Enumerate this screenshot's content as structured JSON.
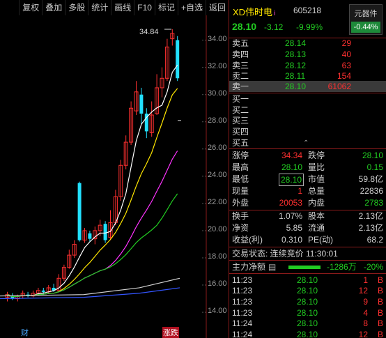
{
  "toolbar": [
    "复权",
    "叠加",
    "多股",
    "统计",
    "画线",
    "F10",
    "标记",
    "+自选",
    "返回"
  ],
  "chart": {
    "y_ticks": [
      "34.00",
      "32.00",
      "30.00",
      "28.00",
      "26.00",
      "24.00",
      "22.00",
      "20.00",
      "18.00",
      "16.00",
      "14.00"
    ],
    "peak_label": "34.84",
    "markers": {
      "cai": "财",
      "limit": "涨跌"
    },
    "colors": {
      "up": "#ff3030",
      "down": "#22e0ff",
      "ma5": "#ffffff",
      "ma10": "#ffe600",
      "ma20": "#ff33ff",
      "ma30": "#22cc22"
    }
  },
  "stock": {
    "name": "XD伟时电",
    "i": "i",
    "code": "605218",
    "price": "28.10",
    "change": "-3.12",
    "pct": "-9.99%",
    "element_label": "元器件",
    "element_value": "-0.44%"
  },
  "asks": [
    {
      "label": "卖五",
      "price": "28.14",
      "vol": "29"
    },
    {
      "label": "卖四",
      "price": "28.13",
      "vol": "40"
    },
    {
      "label": "卖三",
      "price": "28.12",
      "vol": "63"
    },
    {
      "label": "卖二",
      "price": "28.11",
      "vol": "154"
    },
    {
      "label": "卖一",
      "price": "28.10",
      "vol": "61062"
    }
  ],
  "bids": [
    "买一",
    "买二",
    "买三",
    "买四",
    "买五"
  ],
  "stats": {
    "zhangting_l": "涨停",
    "zhangting_v": "34.34",
    "dieting_l": "跌停",
    "dieting_v": "28.10",
    "high_l": "最高",
    "high_v": "28.10",
    "liangbi_l": "量比",
    "liangbi_v": "0.15",
    "low_l": "最低",
    "low_v": "28.10",
    "shizhi_l": "市值",
    "shizhi_v": "59.8亿",
    "xianliang_l": "现量",
    "xianliang_v": "1",
    "zongliang_l": "总量",
    "zongliang_v": "22836",
    "waipan_l": "外盘",
    "waipan_v": "20053",
    "neipan_l": "内盘",
    "neipan_v": "2783",
    "huanshou_l": "换手",
    "huanshou_v": "1.07%",
    "guben_l": "股本",
    "guben_v": "2.13亿",
    "jingzi_l": "净资",
    "jingzi_v": "5.85",
    "liutong_l": "流通",
    "liutong_v": "2.13亿",
    "shouyi_l": "收益(利)",
    "shouyi_v": "0.310",
    "pe_l": "PE(动)",
    "pe_v": "68.2"
  },
  "trade_status": "交易状态: 连续竞价 11:30:01",
  "main_flow": {
    "label": "主力净额",
    "value": "-1286万",
    "pct": "-20%"
  },
  "ticks": [
    {
      "time": "11:23",
      "price": "28.10",
      "vol": "1",
      "side": "B"
    },
    {
      "time": "11:23",
      "price": "28.10",
      "vol": "12",
      "side": "B"
    },
    {
      "time": "11:23",
      "price": "28.10",
      "vol": "9",
      "side": "B"
    },
    {
      "time": "11:23",
      "price": "28.10",
      "vol": "4",
      "side": "B"
    },
    {
      "time": "11:24",
      "price": "28.10",
      "vol": "8",
      "side": "B"
    },
    {
      "time": "11:24",
      "price": "28.10",
      "vol": "12",
      "side": "B"
    }
  ]
}
